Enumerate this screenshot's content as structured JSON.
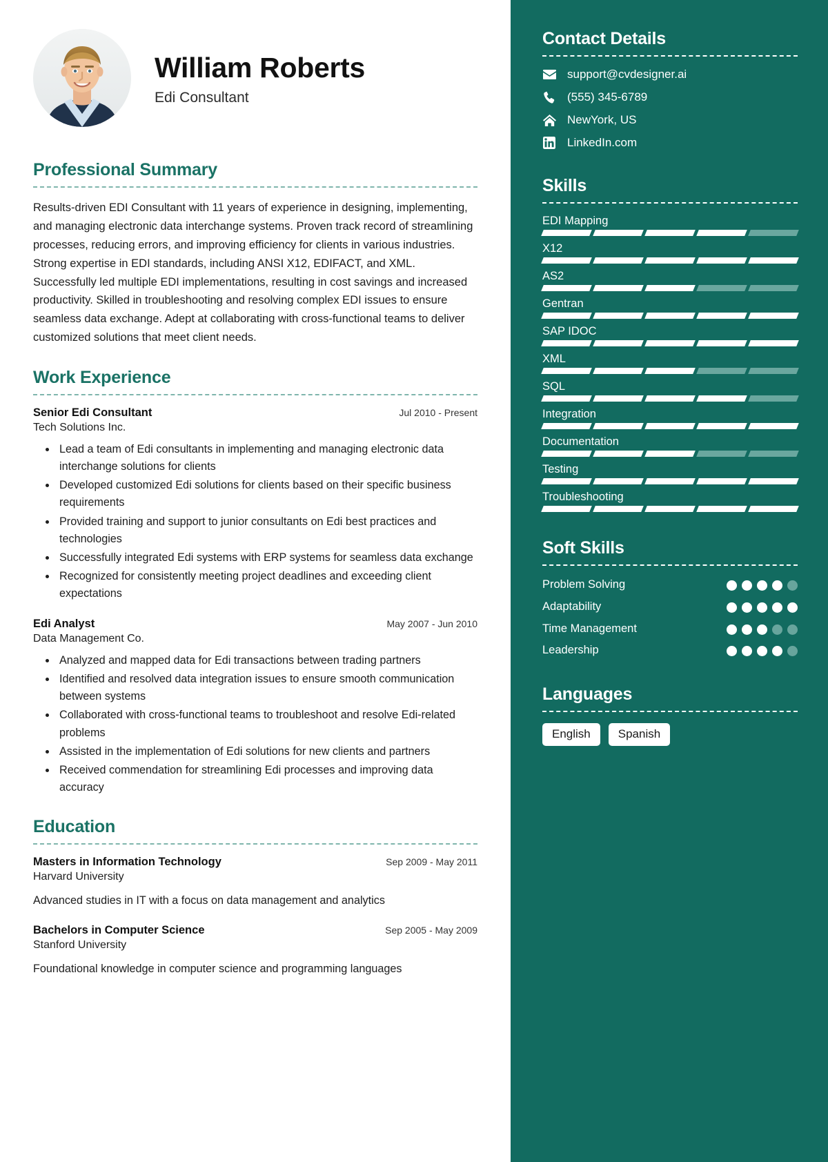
{
  "header": {
    "name": "William Roberts",
    "job_title": "Edi Consultant",
    "avatar_icon": "profile-photo"
  },
  "theme": {
    "accent": "#1a7265",
    "sidebar_bg": "#126b60",
    "dim": "#6aa79f"
  },
  "sections": {
    "summary_title": "Professional Summary",
    "work_title": "Work Experience",
    "education_title": "Education"
  },
  "summary": {
    "text": "Results-driven EDI Consultant with 11 years of experience in designing, implementing, and managing electronic data interchange systems. Proven track record of streamlining processes, reducing errors, and improving efficiency for clients in various industries. Strong expertise in EDI standards, including ANSI X12, EDIFACT, and XML. Successfully led multiple EDI implementations, resulting in cost savings and increased productivity. Skilled in troubleshooting and resolving complex EDI issues to ensure seamless data exchange. Adept at collaborating with cross-functional teams to deliver customized solutions that meet client needs."
  },
  "work": [
    {
      "role": "Senior Edi Consultant",
      "date": "Jul 2010 - Present",
      "org": "Tech Solutions Inc.",
      "bullets": [
        "Lead a team of Edi consultants in implementing and managing electronic data interchange solutions for clients",
        "Developed customized Edi solutions for clients based on their specific business requirements",
        "Provided training and support to junior consultants on Edi best practices and technologies",
        "Successfully integrated Edi systems with ERP systems for seamless data exchange",
        "Recognized for consistently meeting project deadlines and exceeding client expectations"
      ]
    },
    {
      "role": "Edi Analyst",
      "date": "May 2007 - Jun 2010",
      "org": "Data Management Co.",
      "bullets": [
        "Analyzed and mapped data for Edi transactions between trading partners",
        "Identified and resolved data integration issues to ensure smooth communication between systems",
        "Collaborated with cross-functional teams to troubleshoot and resolve Edi-related problems",
        "Assisted in the implementation of Edi solutions for new clients and partners",
        "Received commendation for streamlining Edi processes and improving data accuracy"
      ]
    }
  ],
  "education": [
    {
      "degree": "Masters in Information Technology",
      "date": "Sep 2009 - May 2011",
      "school": "Harvard University",
      "description": "Advanced studies in IT with a focus on data management and analytics"
    },
    {
      "degree": "Bachelors in Computer Science",
      "date": "Sep 2005 - May 2009",
      "school": "Stanford University",
      "description": "Foundational knowledge in computer science and programming languages"
    }
  ],
  "sidebar": {
    "contact": {
      "title": "Contact Details",
      "items": [
        {
          "icon": "envelope-icon",
          "value": "support@cvdesigner.ai"
        },
        {
          "icon": "phone-icon",
          "value": "(555) 345-6789"
        },
        {
          "icon": "home-icon",
          "value": "NewYork, US"
        },
        {
          "icon": "linkedin-icon",
          "value": "LinkedIn.com"
        }
      ]
    },
    "skills": {
      "title": "Skills",
      "segments_total": 5,
      "items": [
        {
          "name": "EDI Mapping",
          "filled": 4
        },
        {
          "name": "X12",
          "filled": 5
        },
        {
          "name": "AS2",
          "filled": 3
        },
        {
          "name": "Gentran",
          "filled": 5
        },
        {
          "name": "SAP IDOC",
          "filled": 5
        },
        {
          "name": "XML",
          "filled": 3
        },
        {
          "name": "SQL",
          "filled": 4
        },
        {
          "name": "Integration",
          "filled": 5
        },
        {
          "name": "Documentation",
          "filled": 3
        },
        {
          "name": "Testing",
          "filled": 5
        },
        {
          "name": "Troubleshooting",
          "filled": 5
        }
      ]
    },
    "soft_skills": {
      "title": "Soft Skills",
      "dots_total": 5,
      "items": [
        {
          "name": "Problem Solving",
          "filled": 4
        },
        {
          "name": "Adaptability",
          "filled": 5
        },
        {
          "name": "Time Management",
          "filled": 3
        },
        {
          "name": "Leadership",
          "filled": 4
        }
      ]
    },
    "languages": {
      "title": "Languages",
      "items": [
        "English",
        "Spanish"
      ]
    }
  }
}
